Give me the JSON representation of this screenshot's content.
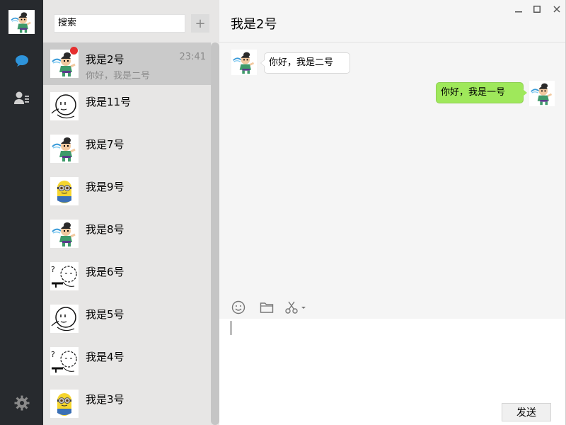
{
  "window": {
    "title": "我是2号"
  },
  "nav": {
    "items": [
      {
        "icon": "chat-icon",
        "active": true
      },
      {
        "icon": "contacts-icon",
        "active": false
      },
      {
        "icon": "settings-icon",
        "active": false
      }
    ]
  },
  "search": {
    "value": "搜索"
  },
  "add_label": "+",
  "contacts": [
    {
      "name": "我是2号",
      "preview": "你好，我是二号",
      "time": "23:41",
      "unread": true,
      "avatar": "boy",
      "selected": true
    },
    {
      "name": "我是11号",
      "preview": "",
      "time": "",
      "unread": false,
      "avatar": "face",
      "selected": false
    },
    {
      "name": "我是7号",
      "preview": "",
      "time": "",
      "unread": false,
      "avatar": "boy",
      "selected": false
    },
    {
      "name": "我是9号",
      "preview": "",
      "time": "",
      "unread": false,
      "avatar": "minion",
      "selected": false
    },
    {
      "name": "我是8号",
      "preview": "",
      "time": "",
      "unread": false,
      "avatar": "boy",
      "selected": false
    },
    {
      "name": "我是6号",
      "preview": "",
      "time": "",
      "unread": false,
      "avatar": "sketch",
      "selected": false
    },
    {
      "name": "我是5号",
      "preview": "",
      "time": "",
      "unread": false,
      "avatar": "face",
      "selected": false
    },
    {
      "name": "我是4号",
      "preview": "",
      "time": "",
      "unread": false,
      "avatar": "sketch",
      "selected": false
    },
    {
      "name": "我是3号",
      "preview": "",
      "time": "",
      "unread": false,
      "avatar": "minion",
      "selected": false
    }
  ],
  "chat": {
    "messages": [
      {
        "direction": "incoming",
        "text": "你好，我是二号"
      },
      {
        "direction": "outgoing",
        "text": "你好，我是一号"
      }
    ],
    "toolbar": [
      "emoji-icon",
      "folder-icon",
      "scissors-icon"
    ],
    "input_value": "",
    "send_label": "发送"
  },
  "colors": {
    "nav_bg": "#272a2e",
    "list_bg": "#e7e6e5",
    "selected_bg": "#cacaca",
    "chat_bg": "#f5f5f5",
    "outgoing_bubble": "#9fe85b",
    "unread_dot": "#e62f2f"
  }
}
